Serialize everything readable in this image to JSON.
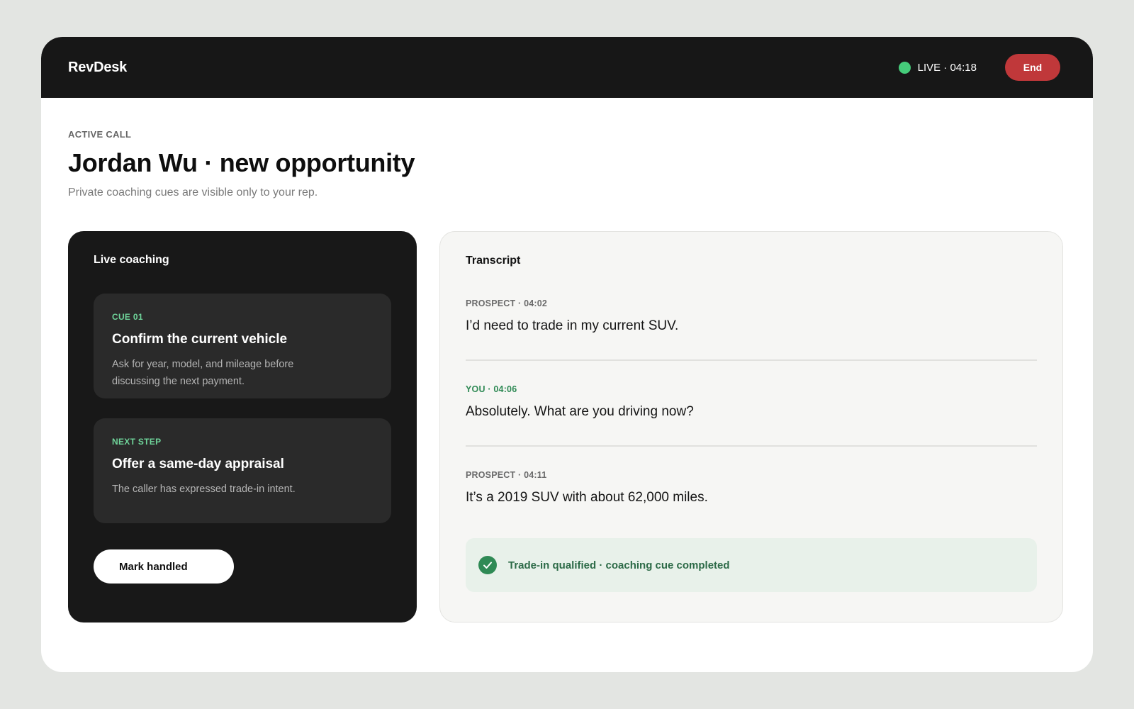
{
  "app": {
    "brand": "RevDesk",
    "live_status": "LIVE · 04:18",
    "end_label": "End"
  },
  "header": {
    "eyebrow": "ACTIVE CALL",
    "title": "Jordan Wu · new opportunity",
    "subtitle": "Private coaching cues are visible only to your rep."
  },
  "coaching": {
    "title": "Live coaching",
    "cues": [
      {
        "label": "CUE 01",
        "title": "Confirm the current vehicle",
        "body": "Ask for year, model, and mileage before discussing the next payment."
      },
      {
        "label": "NEXT STEP",
        "title": "Offer a same-day appraisal",
        "body": "The caller has expressed trade-in intent."
      }
    ],
    "mark_handled_label": "Mark handled"
  },
  "transcript": {
    "title": "Transcript",
    "messages": [
      {
        "meta": "PROSPECT · 04:02",
        "text": "I’d need to trade in my current SUV."
      },
      {
        "meta": "YOU · 04:06",
        "text": "Absolutely. What are you driving now?"
      },
      {
        "meta": "PROSPECT · 04:11",
        "text": "It’s a 2019 SUV with about 62,000 miles."
      }
    ],
    "status": "Trade-in qualified · coaching cue completed"
  },
  "colors": {
    "background": "#e3e5e2",
    "topbar": "#171717",
    "live_dot": "#45cc7a",
    "end_button": "#c0383a",
    "accent_green": "#6fd49a",
    "you_green": "#2f8a55",
    "status_bg": "#e8f1ea"
  },
  "icons": {
    "live_indicator": "live-dot-icon",
    "status": "check-circle-icon"
  }
}
